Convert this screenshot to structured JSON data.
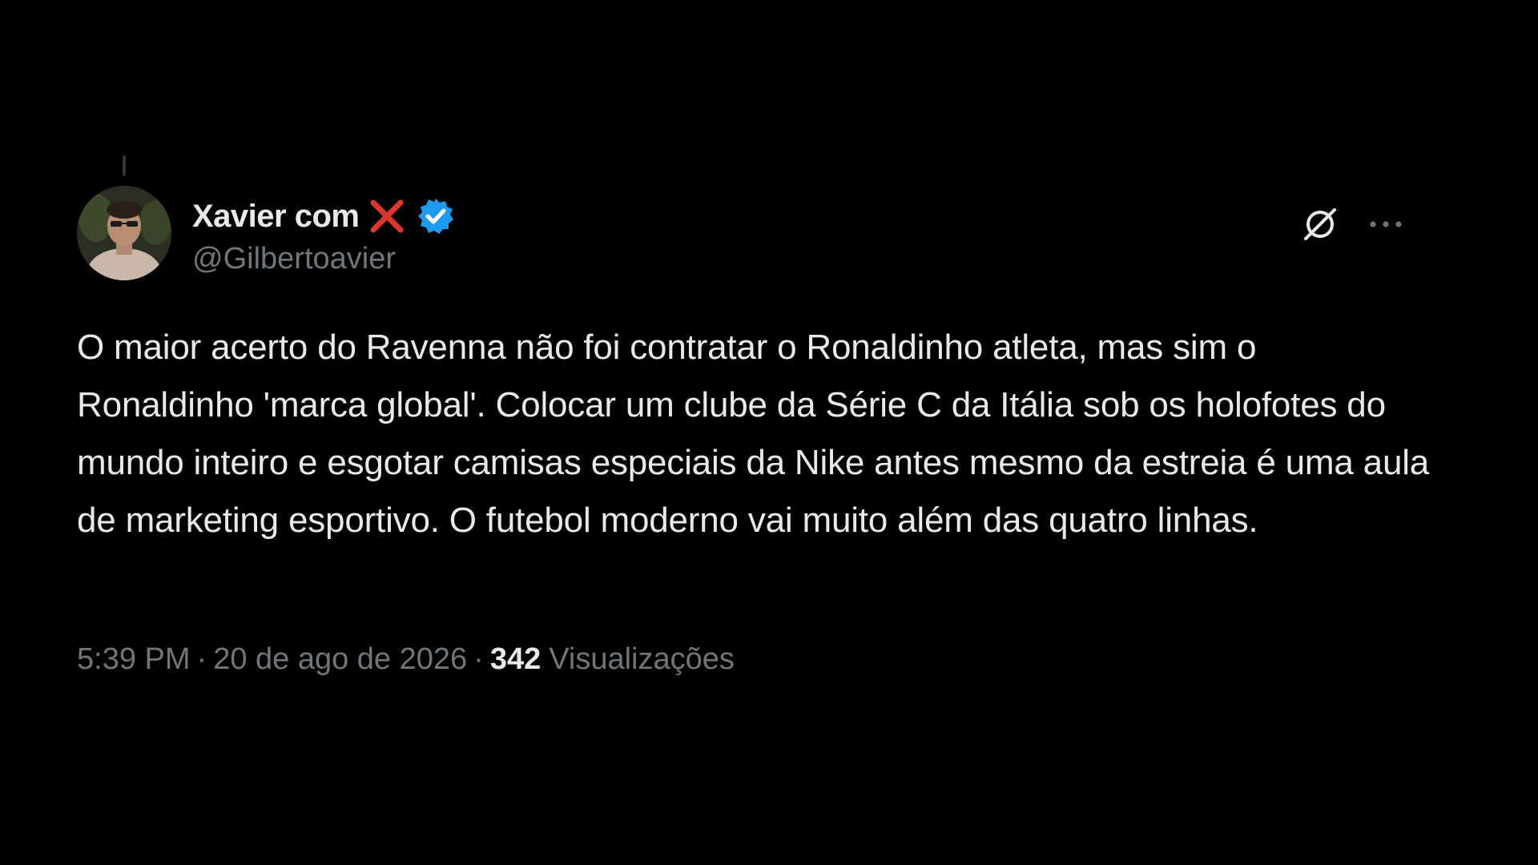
{
  "post": {
    "author": {
      "display_name": "Xavier com",
      "handle": "@Gilbertoavier",
      "verified": true,
      "name_emoji": "x-mark-icon",
      "avatar": "avatar"
    },
    "text": "O maior acerto do Ravenna não foi contratar o Ronaldinho atleta, mas sim o Ronaldinho 'marca global'. Colocar um clube da Série C da Itália sob os holofotes do mundo inteiro e esgotar camisas especiais da Nike antes mesmo da estreia é uma aula de marketing esportivo. O futebol moderno vai muito além das quatro linhas.",
    "time": "5:39 PM",
    "date": "20 de ago de 2026",
    "separator": "·",
    "views_count": "342",
    "views_label": "Visualizações"
  },
  "actions": {
    "grok_icon": "grok-icon",
    "more_icon": "more-options-icon"
  },
  "colors": {
    "background": "#000000",
    "primary_text": "#e7e9ea",
    "secondary_text": "#71767b",
    "verified_blue": "#1d9bf0",
    "x_mark_red": "#e0352b"
  }
}
